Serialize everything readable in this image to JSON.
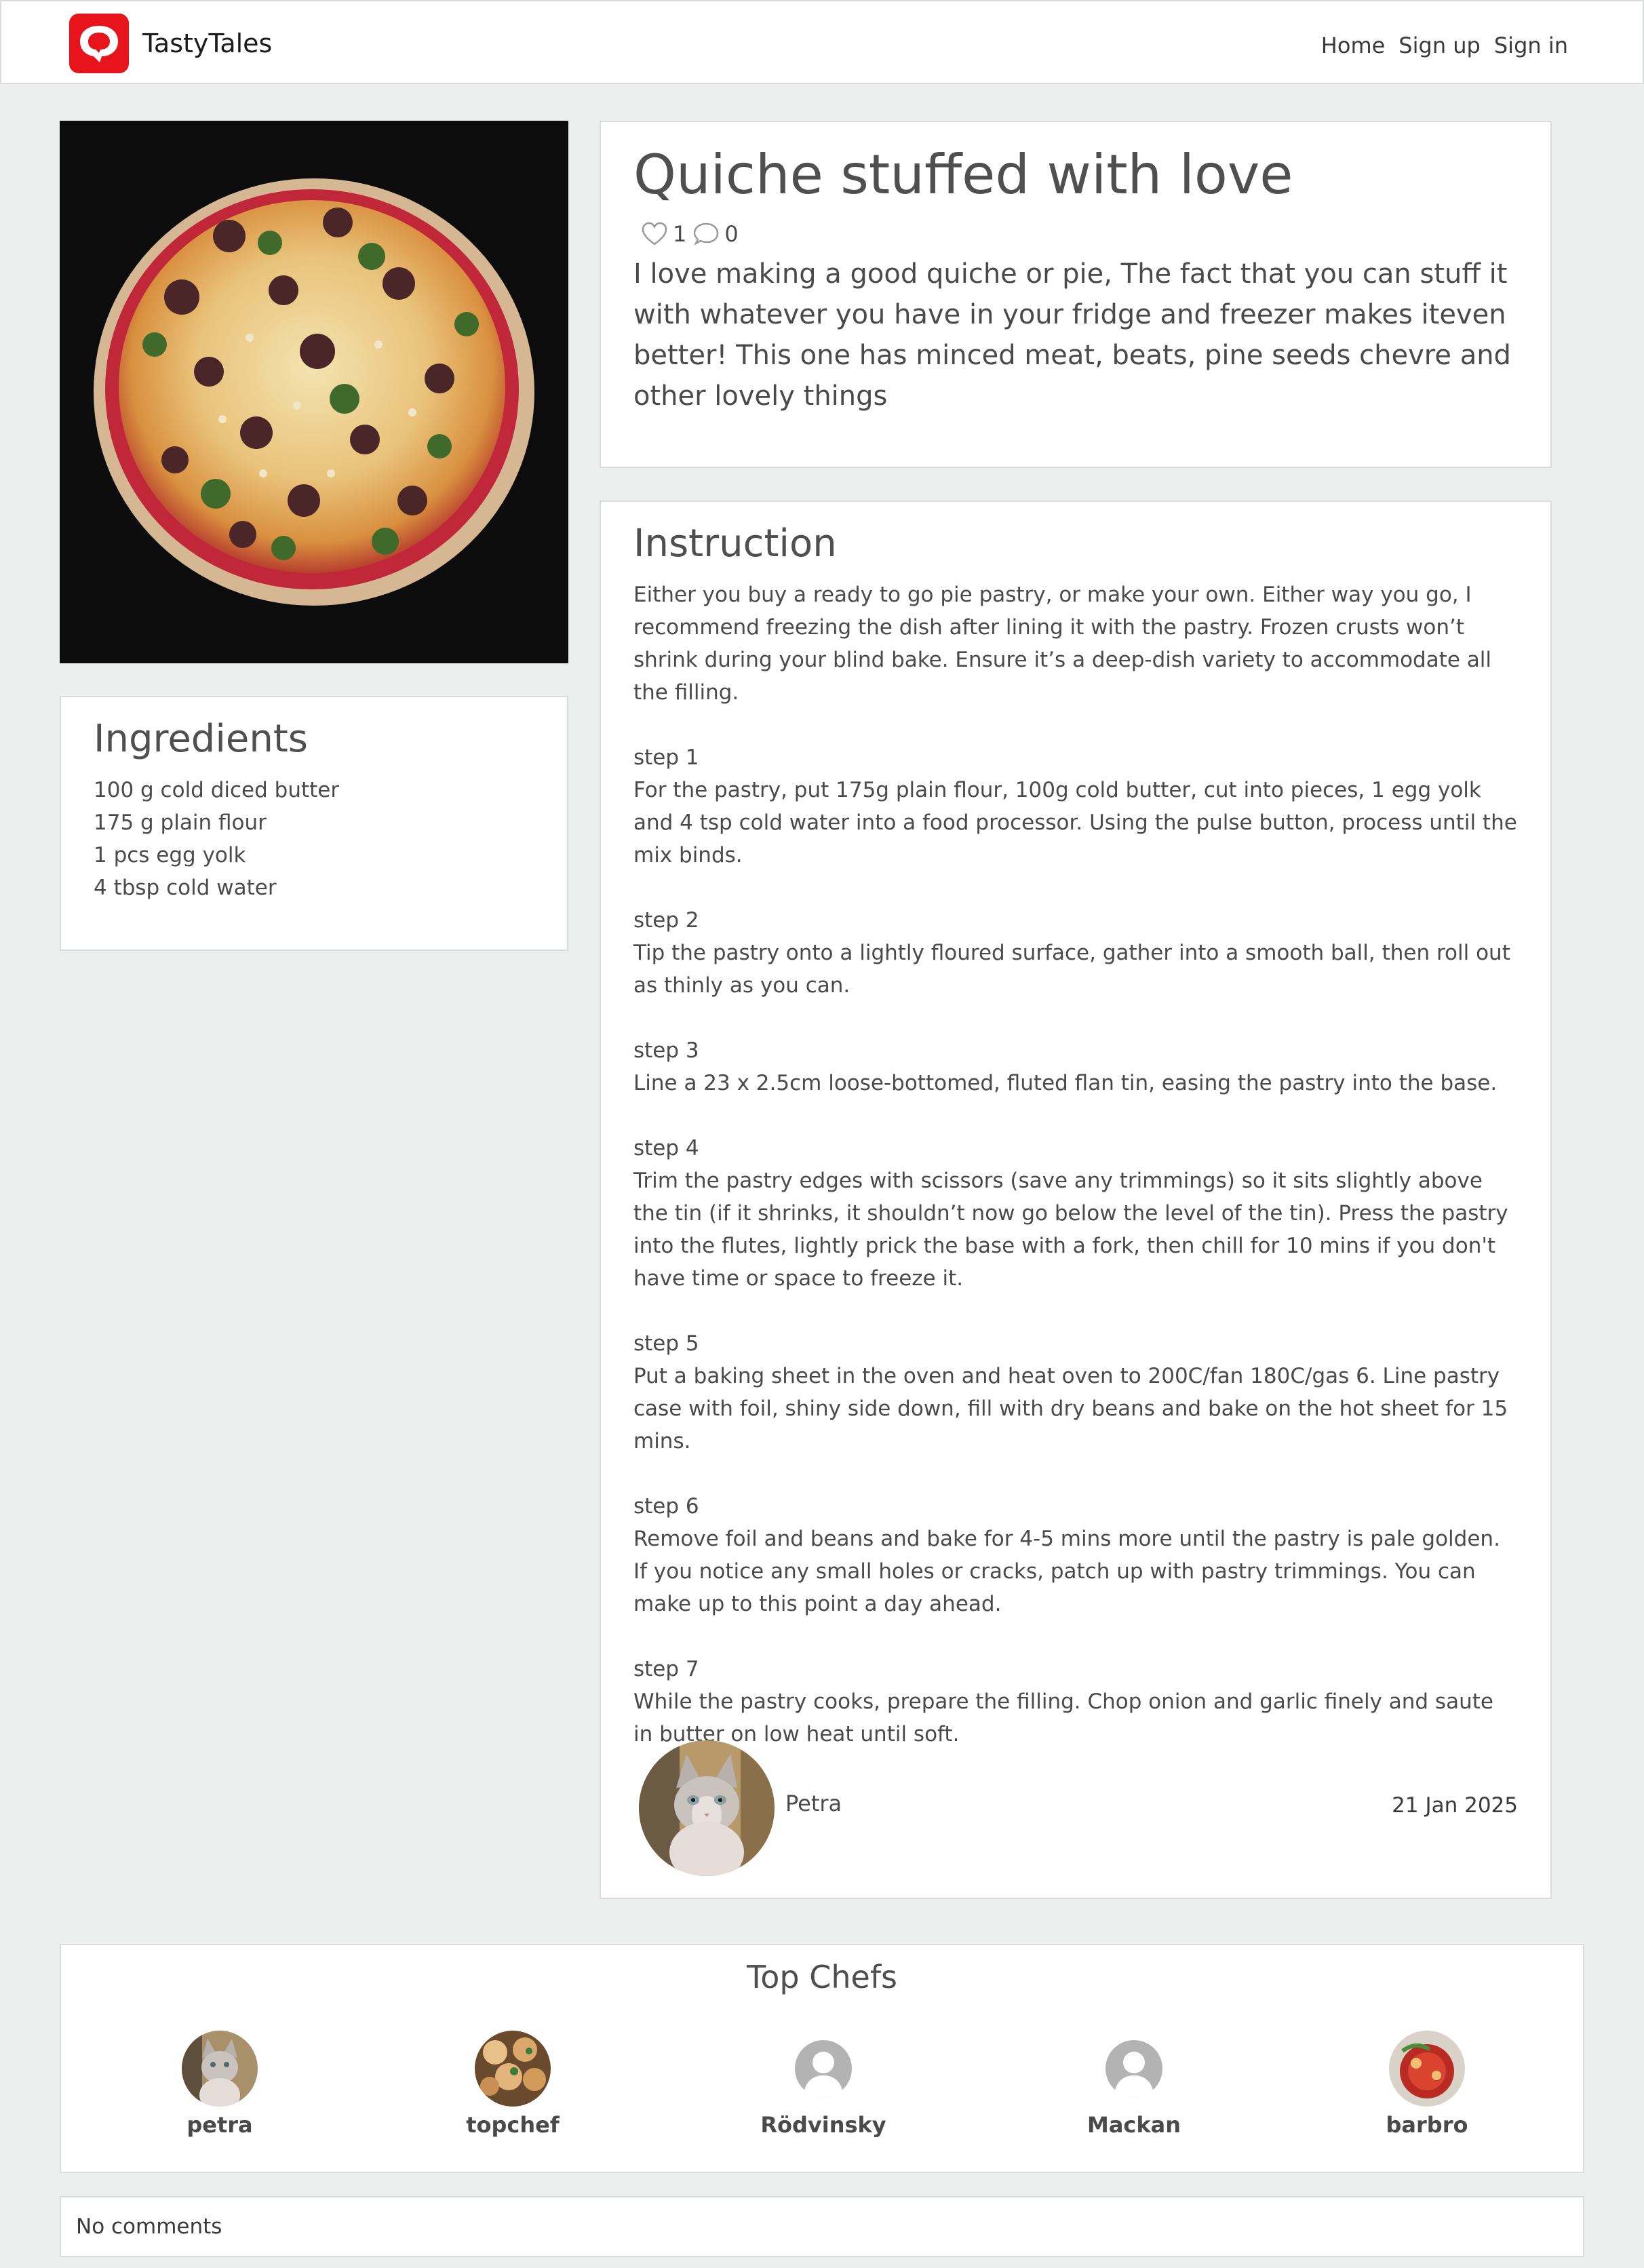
{
  "brand": {
    "name": "TastyTales",
    "accent_color": "#e8141c",
    "logo_icon": "chat-bubble-logo"
  },
  "nav": {
    "items": [
      {
        "label": "Home"
      },
      {
        "label": "Sign up"
      },
      {
        "label": "Sign in"
      }
    ]
  },
  "recipe": {
    "title": "Quiche stuffed with love",
    "likes": "1",
    "comments_count": "0",
    "description": "I love making a good quiche or pie, The fact that you can stuff it with whatever you have in your fridge and freezer makes iteven better! This one has minced meat, beats, pine seeds chevre and other lovely things",
    "image": "quiche-photo"
  },
  "ingredients": {
    "heading": "Ingredients",
    "items": [
      "100 g cold diced butter",
      "175 g plain flour",
      "1 pcs egg yolk",
      "4 tbsp cold water"
    ]
  },
  "instruction": {
    "heading": "Instruction",
    "intro": "Either you buy a ready to go pie pastry, or make your own. Either way you go, I recommend   freezing the dish after lining it with the pastry. Frozen crusts won’t shrink during your blind bake. Ensure it’s a deep-dish variety to accommodate all the filling.",
    "steps": [
      {
        "title": "step 1",
        "text": "For the pastry, put 175g plain flour, 100g cold butter, cut into pieces, 1 egg yolk and 4 tsp cold water into a food processor. Using the pulse button, process until the mix binds."
      },
      {
        "title": "step 2",
        "text": "Tip the pastry onto a lightly floured surface, gather into a smooth ball, then roll out as thinly as you can."
      },
      {
        "title": "step 3",
        "text": "Line a 23 x 2.5cm loose-bottomed, fluted flan tin, easing the pastry into the base."
      },
      {
        "title": "step 4",
        "text": "Trim the pastry edges with scissors (save any trimmings) so it sits slightly above the tin (if it shrinks, it shouldn’t now go below the level of the tin). Press the pastry into the flutes, lightly prick the base with a fork, then chill for 10 mins if you don't have time or space to freeze it."
      },
      {
        "title": "step 5",
        "text": "Put a baking sheet in the oven and heat oven to 200C/fan 180C/gas 6. Line pastry case with foil, shiny side down, fill with dry beans and bake on the hot sheet for 15 mins."
      },
      {
        "title": "step 6",
        "text": "Remove foil and beans and bake for 4-5 mins more until the pastry is pale golden. If you notice any small holes or cracks, patch up with pastry trimmings. You can make up to this point a day ahead."
      },
      {
        "title": "step 7",
        "text": "While the pastry cooks, prepare the filling. Chop onion and garlic finely and saute in butter on low heat until soft."
      }
    ],
    "author": "Petra",
    "date": "21 Jan 2025"
  },
  "top_chefs": {
    "heading": "Top Chefs",
    "chefs": [
      {
        "name": "petra",
        "avatar": "cat-photo"
      },
      {
        "name": "topchef",
        "avatar": "food-photo"
      },
      {
        "name": "Rödvinsky",
        "avatar": "default-user-icon"
      },
      {
        "name": "Mackan",
        "avatar": "default-user-icon"
      },
      {
        "name": "barbro",
        "avatar": "food-photo"
      }
    ]
  },
  "comments": {
    "empty_text": "No comments"
  }
}
